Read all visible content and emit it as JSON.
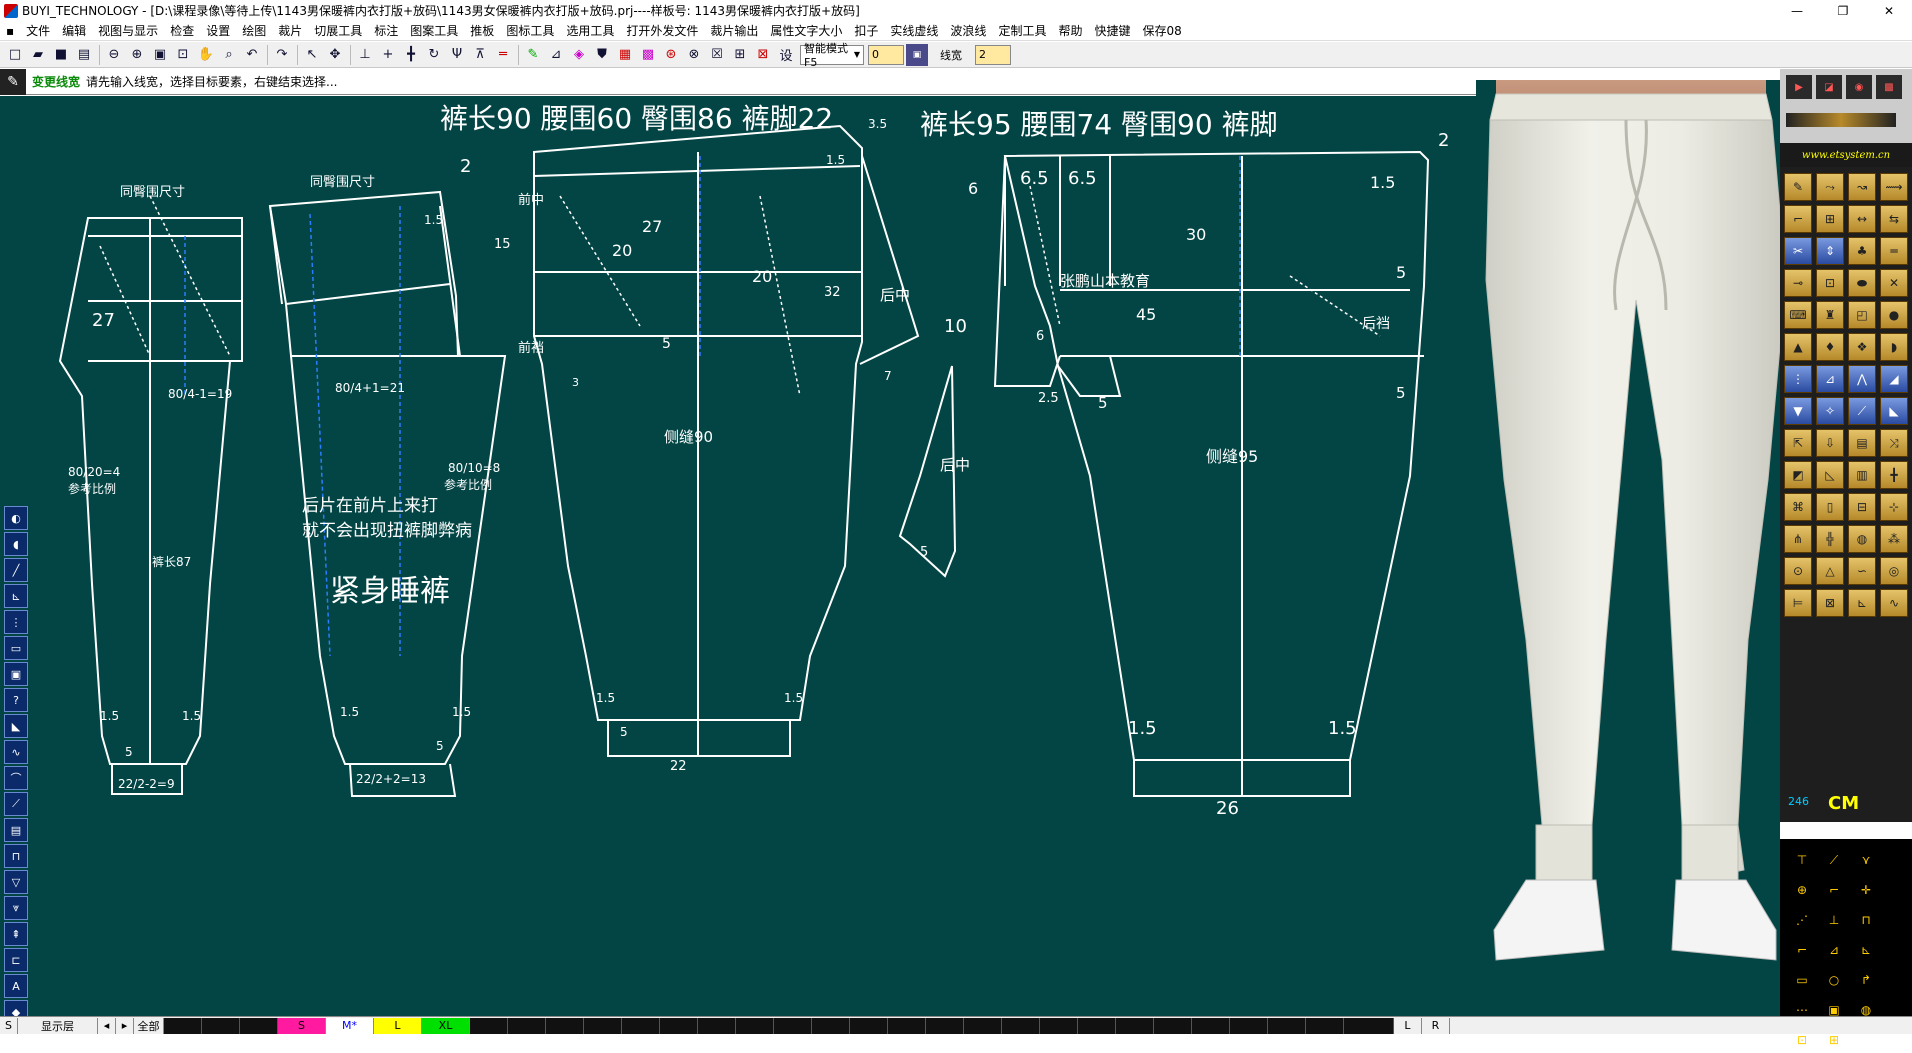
{
  "window": {
    "app_name": "BUYI_TECHNOLOGY",
    "title": "BUYI_TECHNOLOGY - [D:\\课程录像\\等待上传\\1143男保暖裤内衣打版+放码\\1143男女保暖裤内衣打版+放码.prj----样板号: 1143男保暖裤内衣打版+放码]",
    "controls": [
      "—",
      "❐",
      "✕"
    ]
  },
  "menu": [
    "文件",
    "编辑",
    "视图与显示",
    "检查",
    "设置",
    "绘图",
    "裁片",
    "切展工具",
    "标注",
    "图案工具",
    "推板",
    "图标工具",
    "选用工具",
    "打开外发文件",
    "裁片输出",
    "属性文字大小",
    "扣子",
    "实线虚线",
    "波浪线",
    "定制工具",
    "帮助",
    "快捷键",
    "保存08"
  ],
  "toolbar": {
    "mode_label": "设",
    "mode_value": "智能模式F5",
    "field1_value": "0",
    "linewidth_label": "线宽",
    "linewidth_value": "2"
  },
  "status": {
    "command": "变更线宽",
    "prompt": "请先输入线宽，选择目标要素，右键结束选择..."
  },
  "canvas": {
    "heading_left": "裤长90   腰围60   臀围86   裤脚22",
    "heading_right": "裤长95   腰围74   臀围90   裤脚",
    "labels": {
      "same_hip_1": "同臀围尺寸",
      "same_hip_2": "同臀围尺寸",
      "n27a": "27",
      "calc1": "80/4-1=19",
      "calc2": "80/4+1=21",
      "ref1": "80/20=4",
      "ref1b": "参考比例",
      "ref2": "80/10=8",
      "ref2b": "参考比例",
      "length87": "裤长87",
      "note1": "后片在前片上来打",
      "note2": "就不会出现扭裤脚弊病",
      "title_sleep": "紧身睡裤",
      "n15a": "1.5",
      "n15b": "1.5",
      "n15c": "1.5",
      "n15d": "1.5",
      "n15e": "1.5",
      "n5a": "5",
      "n5b": "5",
      "calc3": "22/2-2=9",
      "calc4": "22/2+2=13",
      "n2a": "2",
      "n15f": "1.5",
      "n15g": "15",
      "front_center": "前中",
      "front_crotch": "前裆",
      "n20a": "20",
      "n27b": "27",
      "n20b": "20",
      "n35": "3.5",
      "n15h": "1.5",
      "n32": "32",
      "back_center_1": "后中",
      "n7": "7",
      "n5c": "5",
      "n3": "3",
      "side_seam_90": "侧缝90",
      "n15i": "1.5",
      "n15j": "1.5",
      "n5d": "5",
      "n22": "22",
      "back_center_2": "后中",
      "n5e": "5",
      "n6a": "6",
      "n65a": "6.5",
      "n65b": "6.5",
      "n10": "10",
      "n6b": "6",
      "n25": "2.5",
      "n5f": "5",
      "n2b": "2",
      "n15k": "1.5",
      "n30": "30",
      "school": "张鹏山本教育",
      "n45": "45",
      "n5g": "5",
      "back_crotch": "后裆",
      "n5h": "5",
      "side_seam_95": "侧缝95",
      "n15l": "1.5",
      "n15m": "1.5",
      "n26": "26"
    }
  },
  "right_panel": {
    "logo": "www.etsystem.cn",
    "unit": "CM",
    "counter": "246"
  },
  "bottom": {
    "layer_label": "显示层",
    "all_label": "全部",
    "sizes": [
      "S",
      "M*",
      "L",
      "XL"
    ],
    "size_colors": [
      "#ff1aa0",
      "#ffffff",
      "#ffff00",
      "#00e000"
    ],
    "right_labels": [
      "L",
      "R"
    ]
  },
  "colors": {
    "canvas_bg": "#024544",
    "pattern_line": "#ffffff",
    "guide_line": "#2a7dff"
  }
}
